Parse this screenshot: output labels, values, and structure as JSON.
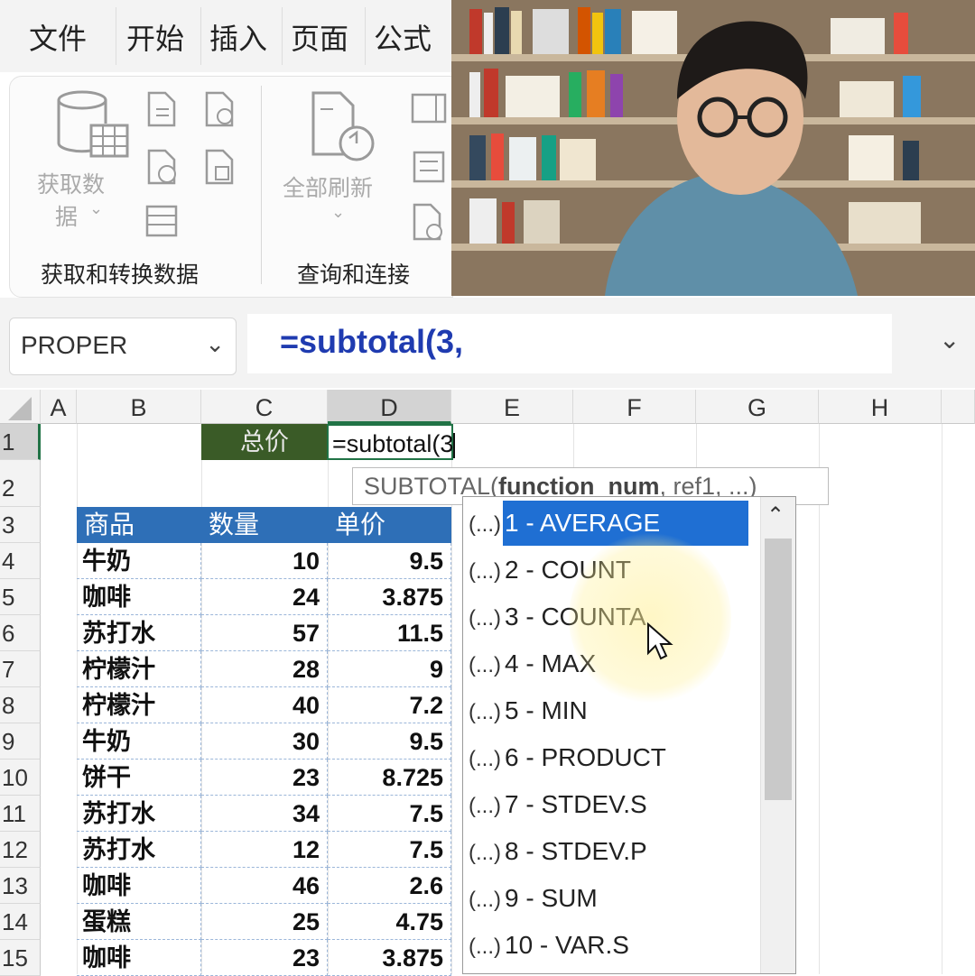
{
  "ribbon": {
    "tabs": [
      "文件",
      "开始",
      "插入",
      "页面",
      "公式"
    ],
    "get_data_label": "获取数",
    "get_data_label_line2": "据",
    "refresh_all_label": "全部刷新",
    "group_get_transform": "获取和转换数据",
    "group_queries": "查询和连接"
  },
  "formula_bar": {
    "name_box": "PROPER",
    "formula": "=subtotal(3,"
  },
  "columns": [
    "A",
    "B",
    "C",
    "D",
    "E",
    "F",
    "G",
    "H"
  ],
  "rows": [
    "1",
    "2",
    "3",
    "4",
    "5",
    "6",
    "7",
    "8",
    "9",
    "10",
    "11",
    "12",
    "13",
    "14",
    "15"
  ],
  "cells": {
    "c1": "总价",
    "d1_editing": "=subtotal(3"
  },
  "table": {
    "headers": [
      "商品",
      "数量",
      "单价"
    ],
    "rows": [
      [
        "牛奶",
        "10",
        "9.5"
      ],
      [
        "咖啡",
        "24",
        "3.875"
      ],
      [
        "苏打水",
        "57",
        "11.5"
      ],
      [
        "柠檬汁",
        "28",
        "9"
      ],
      [
        "柠檬汁",
        "40",
        "7.2"
      ],
      [
        "牛奶",
        "30",
        "9.5"
      ],
      [
        "饼干",
        "23",
        "8.725"
      ],
      [
        "苏打水",
        "34",
        "7.5"
      ],
      [
        "苏打水",
        "12",
        "7.5"
      ],
      [
        "咖啡",
        "46",
        "2.6"
      ],
      [
        "蛋糕",
        "25",
        "4.75"
      ],
      [
        "咖啡",
        "23",
        "3.875"
      ]
    ]
  },
  "syntax_tooltip": {
    "fn": "SUBTOTAL(",
    "arg_bold": "function_num",
    "rest": ", ref1, ...)"
  },
  "function_list": {
    "icon_text": "(...)",
    "items": [
      "1 - AVERAGE",
      "2 - COUNT",
      "3 - COUNTA",
      "4 - MAX",
      "5 - MIN",
      "6 - PRODUCT",
      "7 - STDEV.S",
      "8 - STDEV.P",
      "9 - SUM",
      "10 - VAR.S"
    ],
    "active_index": 0
  },
  "colors": {
    "accent_green": "#217346",
    "table_header_blue": "#2e6fb7",
    "selection_blue": "#1f6fd3",
    "formula_blue": "#1f3bb0"
  }
}
